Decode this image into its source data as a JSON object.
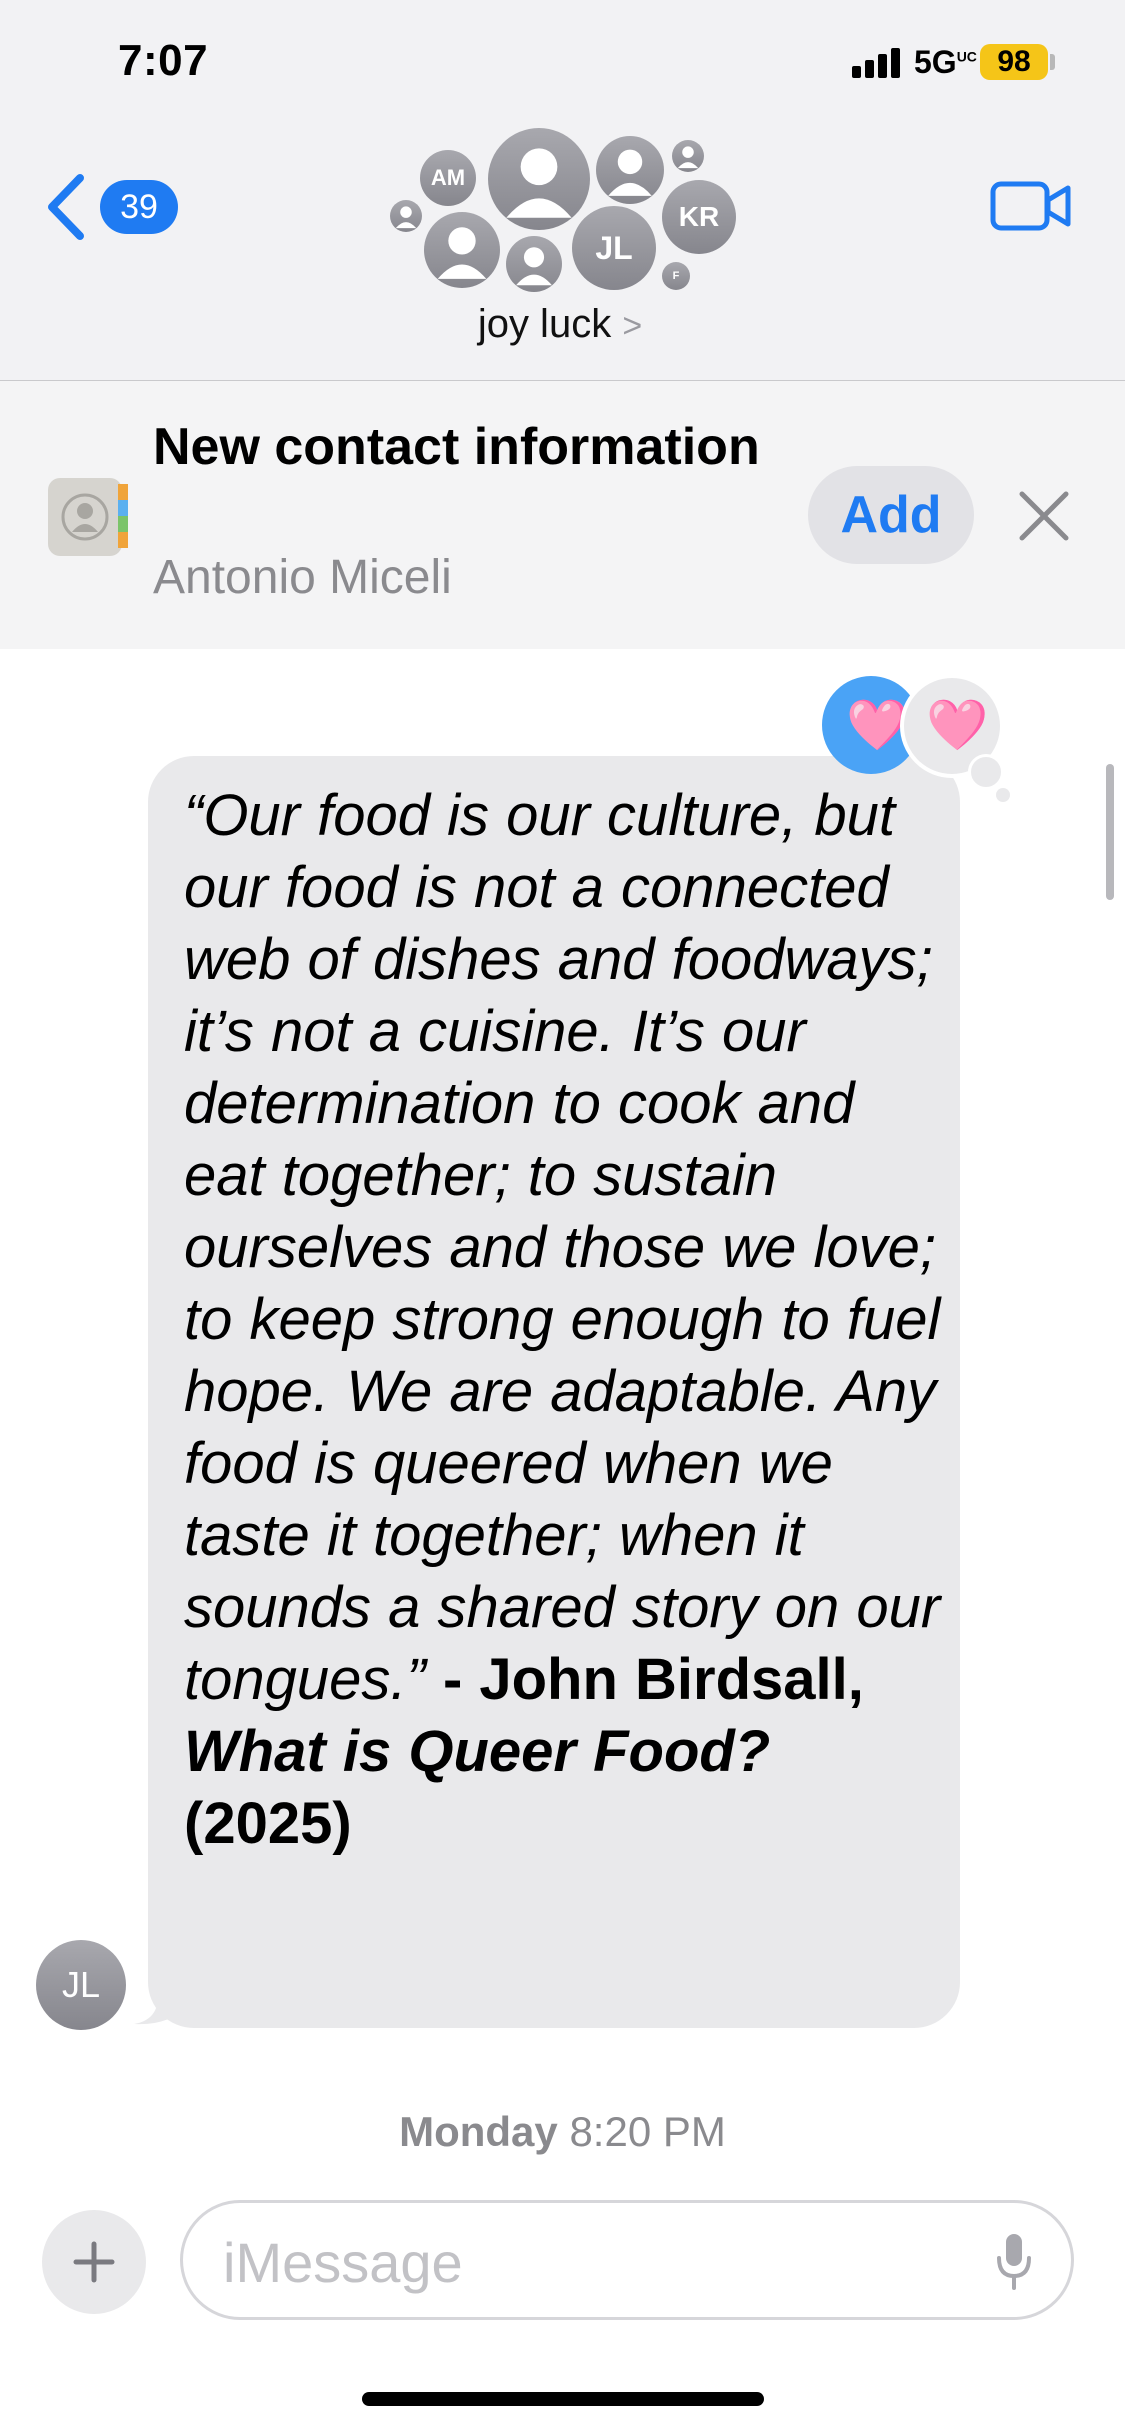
{
  "status_bar": {
    "time": "7:07",
    "network": "5G",
    "network_suffix": "UC",
    "battery": "98"
  },
  "header": {
    "back_count": "39",
    "group_name": "joy luck",
    "group_chevron": ">",
    "avatars": [
      {
        "initials": "AM"
      },
      {
        "initials": "JL"
      },
      {
        "initials": "KR"
      },
      {
        "initials": "F"
      }
    ]
  },
  "contact_banner": {
    "title": "New contact information",
    "subtitle": "Antonio Miceli",
    "add_label": "Add"
  },
  "message": {
    "quote": "“Our food is our culture, but our food is not a connected web of dishes and foodways; it’s not a cuisine. It’s our determination to cook and eat together; to sustain ourselves and those we love; to keep strong enough to fuel hope. We are adaptable. Any food is queered when we taste it together; when it sounds a shared story on our tongues.”",
    "author": " - John Birdsall,",
    "book": "What is Queer Food?",
    "year": "(2025)",
    "sender_initials": "JL",
    "reactions": [
      "🩷",
      "🩷"
    ]
  },
  "timestamp": {
    "day": "Monday",
    "time": "8:20 PM"
  },
  "compose": {
    "placeholder": "iMessage"
  },
  "colors": {
    "accent": "#1f7bf2",
    "bubble_gray": "#e9e9eb",
    "battery_yellow": "#f5c518"
  }
}
